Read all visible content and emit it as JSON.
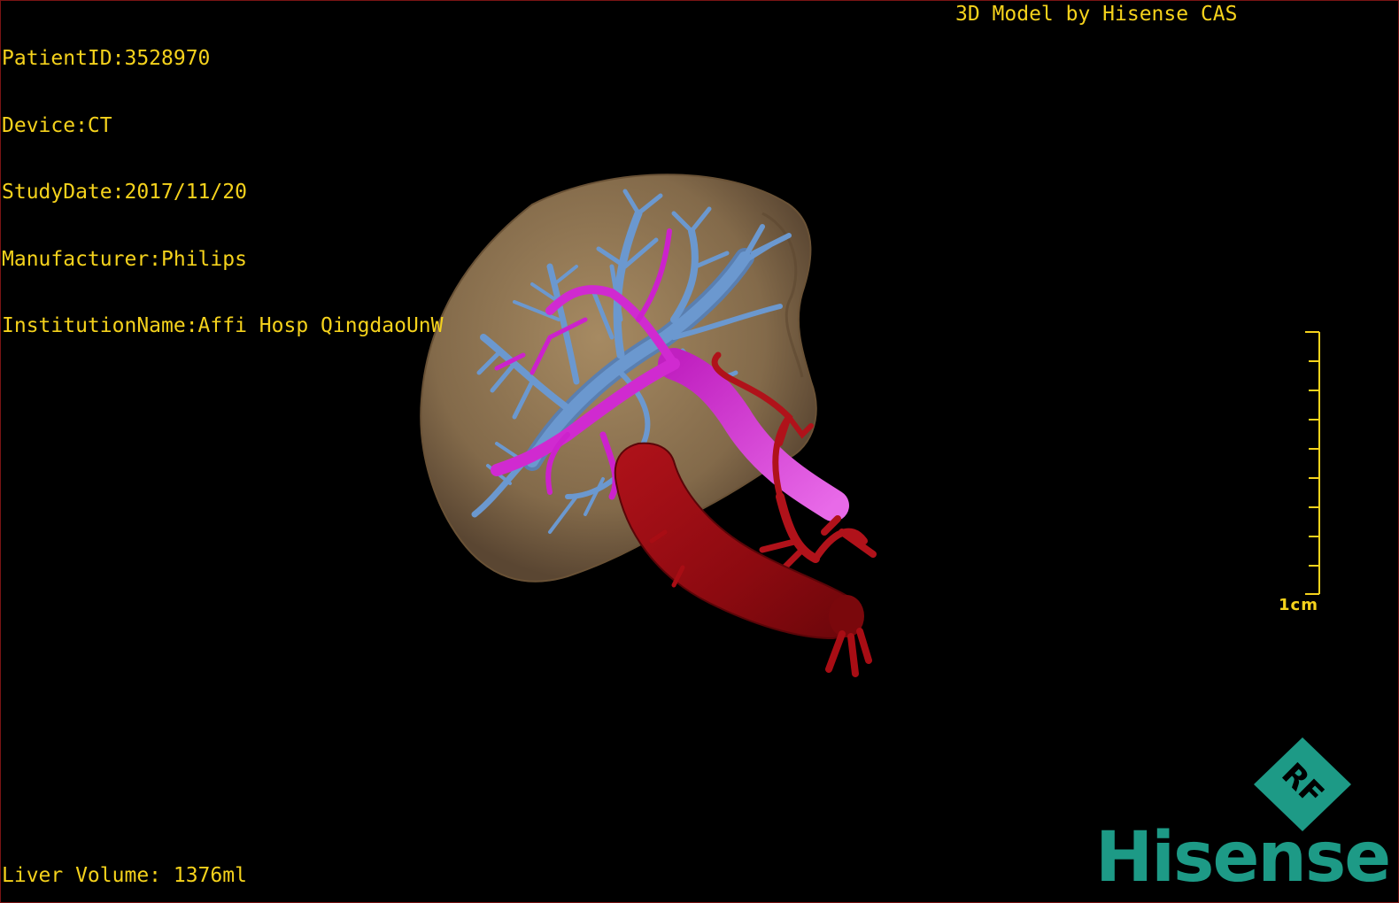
{
  "patient": {
    "id_line": "PatientID:3528970",
    "device_line": "Device:CT",
    "study_date_line": "StudyDate:2017/11/20",
    "manufacturer_line": "Manufacturer:Philips",
    "institution_line": "InstitutionName:Affi Hosp QingdaoUnW"
  },
  "credit": "3D Model by Hisense CAS",
  "liver_volume": "Liver Volume: 1376ml",
  "scale": {
    "label": "1cm"
  },
  "logo": {
    "badge_text": "RF",
    "brand": "Hisense",
    "brand_color": "#1d9a86"
  },
  "colors": {
    "overlay_text": "#f5d21c",
    "liver": "#8a7150",
    "hepatic_vein": "#5f8fc8",
    "portal_vein": "#d632d6",
    "artery": "#a80d14"
  }
}
